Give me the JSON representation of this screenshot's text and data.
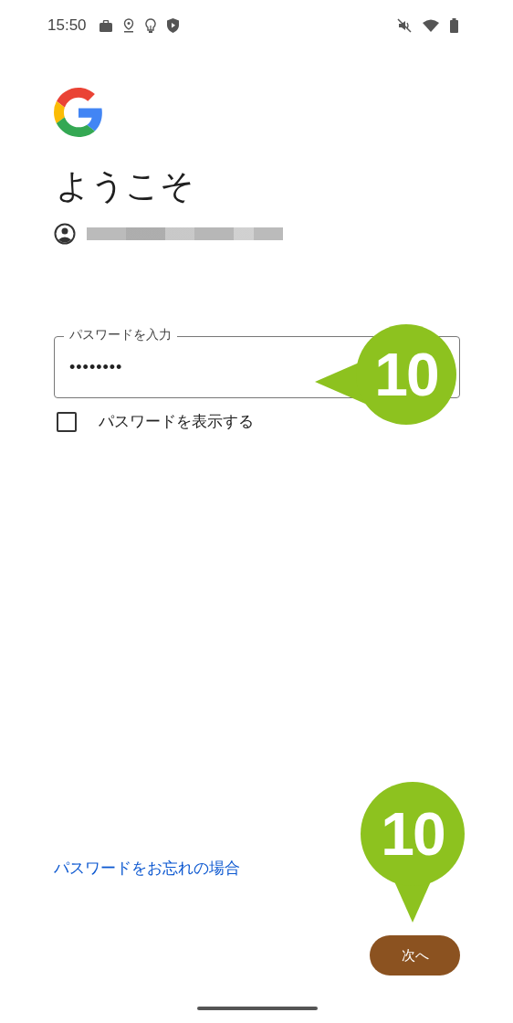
{
  "status_bar": {
    "time": "15:50"
  },
  "title": "ようこそ",
  "password_field": {
    "label": "パスワードを入力",
    "value": "••••••••"
  },
  "show_password": {
    "label": "パスワードを表示する",
    "checked": false
  },
  "forgot_link": "パスワードをお忘れの場合",
  "next_button": "次へ",
  "callouts": [
    {
      "label": "10",
      "kind": "left"
    },
    {
      "label": "10",
      "kind": "down"
    }
  ]
}
